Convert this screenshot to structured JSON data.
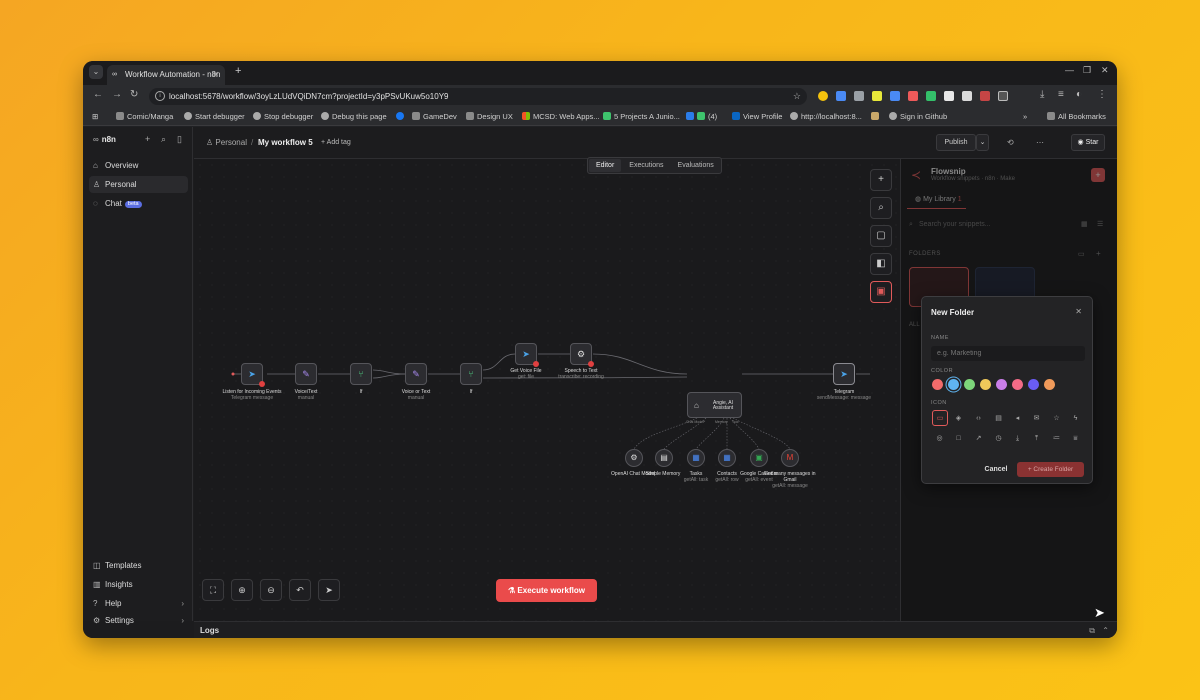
{
  "browser": {
    "tab_title": "Workflow Automation - n8n",
    "url": "localhost:5678/workflow/3oyLzLUdVQiDN7cm?projectId=y3pPSvUKuw5o10Y9",
    "bookmarks": [
      "Comic/Manga",
      "Start debugger",
      "Stop debugger",
      "Debug this page",
      "GameDev",
      "Design UX",
      "MCSD: Web Apps...",
      "5 Projects A Junio...",
      "(4)",
      "View Profile",
      "http://localhost:8...",
      "Sign in Github"
    ],
    "all_bookmarks": "All Bookmarks"
  },
  "sidebar": {
    "brand": "n8n",
    "top_items": [
      {
        "label": "Overview",
        "icon": "home-icon"
      },
      {
        "label": "Personal",
        "icon": "user-icon"
      },
      {
        "label": "Chat",
        "icon": "chat-icon",
        "badge": "beta"
      }
    ],
    "bottom_items": [
      {
        "label": "Templates",
        "icon": "templates-icon"
      },
      {
        "label": "Insights",
        "icon": "insights-icon"
      },
      {
        "label": "Help",
        "icon": "help-icon"
      },
      {
        "label": "Settings",
        "icon": "settings-icon"
      }
    ]
  },
  "header": {
    "project": "Personal",
    "separator": "/",
    "workflow_name": "My workflow 5",
    "add_tag": "+ Add tag",
    "publish": "Publish",
    "star": "Star"
  },
  "canvas": {
    "view_tabs": [
      "Editor",
      "Executions",
      "Evaluations"
    ],
    "execute_label": "Execute workflow",
    "nodes": [
      {
        "label": "Listen for Incoming Events",
        "sub": "Telegram message"
      },
      {
        "label": "Voice/Text",
        "sub": "manual"
      },
      {
        "label": "If",
        "sub": ""
      },
      {
        "label": "Voice or Text",
        "sub": "manual"
      },
      {
        "label": "If",
        "sub": ""
      },
      {
        "label": "Get Voice File",
        "sub": "get: file"
      },
      {
        "label": "Speech to Text",
        "sub": "transcribe: recording"
      },
      {
        "label": "Angie, AI Assistant",
        "sub": ""
      },
      {
        "label": "Telegram",
        "sub": "sendMessage: message"
      }
    ],
    "tools": [
      {
        "label": "OpenAI Chat Model",
        "sub": ""
      },
      {
        "label": "Simple Memory",
        "sub": ""
      },
      {
        "label": "Tasks",
        "sub": "getAll: task"
      },
      {
        "label": "Contacts",
        "sub": "getAll: row"
      },
      {
        "label": "Google Calendar",
        "sub": "getAll: event"
      },
      {
        "label": "Get many messages in Gmail",
        "sub": "getAll: message"
      }
    ],
    "agent_ports": [
      "Chat Model*",
      "Memory",
      "Tool"
    ]
  },
  "panel": {
    "title": "Flowsnip",
    "subtitle": "Workflow snippets · n8n · Make",
    "tab": "My Library",
    "tab_count": "1",
    "search_placeholder": "Search your snippets...",
    "section": "FOLDERS",
    "section2": "ALL"
  },
  "modal": {
    "title": "New Folder",
    "name_label": "NAME",
    "name_placeholder": "e.g. Marketing",
    "color_label": "COLOR",
    "icon_label": "ICON",
    "colors": [
      "#f26b6b",
      "#5fb4f0",
      "#7dd67a",
      "#f0c95a",
      "#c97ee8",
      "#f26b86",
      "#6a5cf5",
      "#f09a5a"
    ],
    "cancel": "Cancel",
    "create": "+ Create Folder"
  },
  "logs": {
    "label": "Logs"
  }
}
